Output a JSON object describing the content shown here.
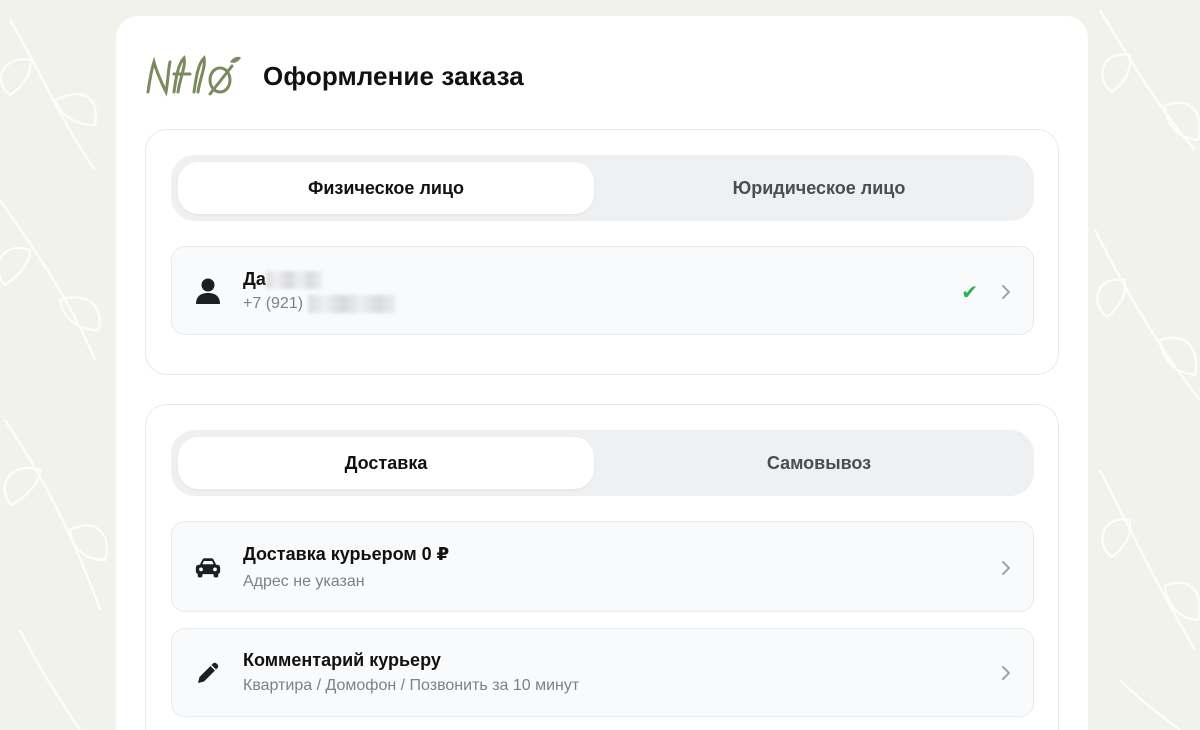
{
  "brand": {
    "logo_text": "Nflo",
    "logo_color": "#7a8a5e"
  },
  "page": {
    "title": "Оформление заказа"
  },
  "customer_type": {
    "tabs": [
      {
        "label": "Физическое лицо",
        "active": true
      },
      {
        "label": "Юридическое лицо",
        "active": false
      }
    ]
  },
  "contact": {
    "name": "Да",
    "phone": "+7 (921)",
    "status_icon": "check-icon",
    "status_glyph": "✔",
    "status_color": "#2fb24c"
  },
  "delivery_type": {
    "tabs": [
      {
        "label": "Доставка",
        "active": true
      },
      {
        "label": "Самовывоз",
        "active": false
      }
    ]
  },
  "delivery": {
    "title": "Доставка курьером 0 ₽",
    "subtitle": "Адрес не указан",
    "icon": "car-icon"
  },
  "comment": {
    "title": "Комментарий курьеру",
    "subtitle": "Квартира / Домофон / Позвонить за 10 минут",
    "icon": "pencil-icon"
  },
  "colors": {
    "background": "#f2f2ec",
    "card": "#ffffff",
    "muted_text": "#7d8187"
  }
}
